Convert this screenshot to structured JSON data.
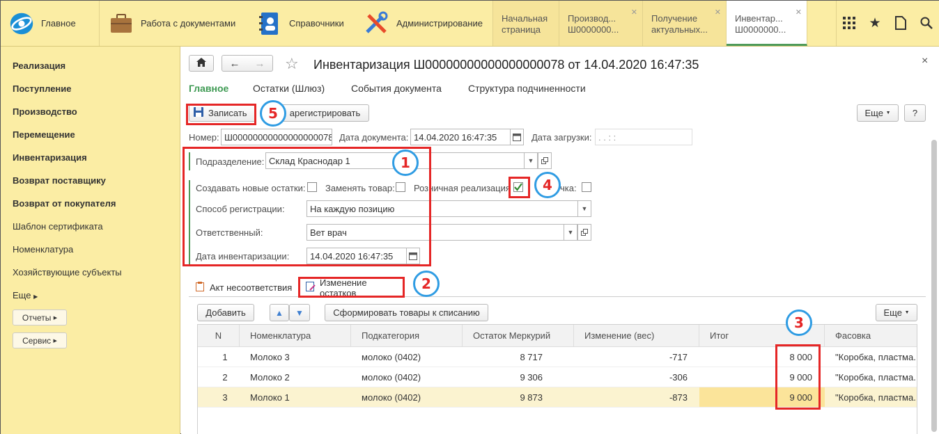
{
  "topbar": {
    "sections": [
      {
        "label": "Главное",
        "icon": "logo-icon"
      },
      {
        "label": "Работа с документами",
        "icon": "briefcase-icon"
      },
      {
        "label": "Справочники",
        "icon": "address-book-icon"
      },
      {
        "label": "Администрирование",
        "icon": "tools-icon"
      }
    ],
    "open_tabs": [
      {
        "label": "Начальная страница"
      },
      {
        "label": "Производ... Ш0000000..."
      },
      {
        "label": "Получение актуальных..."
      },
      {
        "label": "Инвентар... Ш0000000..."
      }
    ],
    "tools": [
      "grid-icon",
      "star-icon",
      "history-icon",
      "search-icon"
    ]
  },
  "sidebar": {
    "items": [
      "Реализация",
      "Поступление",
      "Производство",
      "Перемещение",
      "Инвентаризация",
      "Возврат поставщику",
      "Возврат от покупателя",
      "Шаблон сертификата",
      "Номенклатура",
      "Хозяйствующие субъекты",
      "Еще"
    ],
    "buttons": [
      "Отчеты",
      "Сервис"
    ]
  },
  "doc": {
    "title": "Инвентаризация Ш00000000000000000078 от 14.04.2020 16:47:35",
    "close": "×",
    "nav_tabs": [
      "Главное",
      "Остатки (Шлюз)",
      "События документа",
      "Структура подчиненности"
    ],
    "write_button": "Записать",
    "register_button": "арегистрировать",
    "more_button": "Еще",
    "help_button": "?",
    "number_label": "Номер:",
    "number_value": "Ш00000000000000000078",
    "doc_date_label": "Дата документа:",
    "doc_date_value": "14.04.2020 16:47:35",
    "load_date_label": "Дата загрузки:",
    "load_date_value": " .  .       :  :",
    "division_label": "Подразделение:",
    "division_value": "Склад Краснодар 1",
    "cb_create_label": "Создавать новые остатки:",
    "cb_replace_label": "Заменять товар:",
    "cb_retail_label": "Розничная реализация",
    "cb_last_label": "чка:",
    "method_label": "Способ регистрации:",
    "method_value": "На каждую позицию",
    "responsible_label": "Ответственный:",
    "responsible_value": "Вет врач",
    "inv_date_label": "Дата инвентаризации:",
    "inv_date_value": "14.04.2020 16:47:35"
  },
  "tabs2": [
    "Акт несоответствия",
    "Изменение остатков"
  ],
  "table_toolbar": {
    "add": "Добавить",
    "form": "Сформировать товары к списанию",
    "more": "Еще"
  },
  "table": {
    "columns": [
      "N",
      "Номенклатура",
      "Подкатегория",
      "Остаток Меркурий",
      "Изменение (вес)",
      "Итог",
      "Фасовка"
    ],
    "rows": [
      [
        "1",
        "Молоко 3",
        "молоко (0402)",
        "8 717",
        "-717",
        "8 000",
        "\"Коробка, пластма..."
      ],
      [
        "2",
        "Молоко 2",
        "молоко (0402)",
        "9 306",
        "-306",
        "9 000",
        "\"Коробка, пластма..."
      ],
      [
        "3",
        "Молоко 1",
        "молоко (0402)",
        "9 873",
        "-873",
        "9 000",
        "\"Коробка, пластма..."
      ]
    ]
  },
  "callouts": [
    "1",
    "2",
    "3",
    "4",
    "5"
  ],
  "colors": {
    "accent_green": "#3e9a53",
    "panel_yellow": "#fbeda4",
    "highlight_red": "#e52626",
    "callout_blue": "#2f9ce3"
  }
}
